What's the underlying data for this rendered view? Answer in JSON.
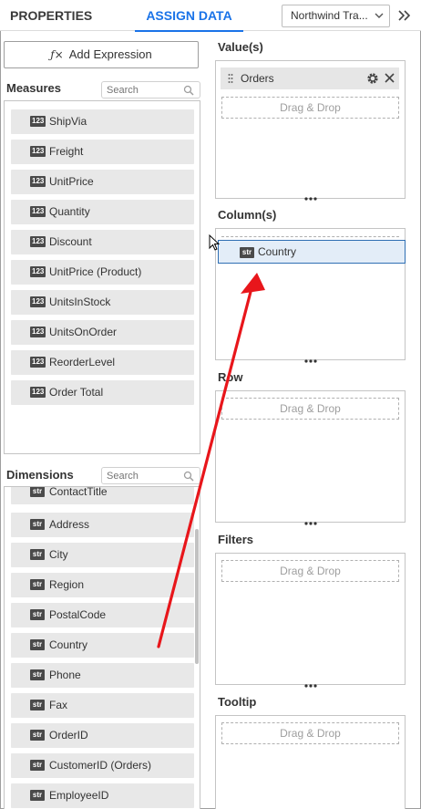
{
  "header": {
    "tabs": [
      {
        "label": "PROPERTIES",
        "active": false
      },
      {
        "label": "ASSIGN DATA",
        "active": true
      }
    ],
    "datasource_label": "Northwind Tra...",
    "accent_color": "#1a73e8"
  },
  "left": {
    "add_expression_label": "Add Expression",
    "measures": {
      "title": "Measures",
      "search_placeholder": "Search",
      "items": [
        {
          "type": "123",
          "name": "ShipVia"
        },
        {
          "type": "123",
          "name": "Freight"
        },
        {
          "type": "123",
          "name": "UnitPrice"
        },
        {
          "type": "123",
          "name": "Quantity"
        },
        {
          "type": "123",
          "name": "Discount"
        },
        {
          "type": "123",
          "name": "UnitPrice (Product)"
        },
        {
          "type": "123",
          "name": "UnitsInStock"
        },
        {
          "type": "123",
          "name": "UnitsOnOrder"
        },
        {
          "type": "123",
          "name": "ReorderLevel"
        },
        {
          "type": "123",
          "name": "Order Total"
        }
      ]
    },
    "dimensions": {
      "title": "Dimensions",
      "search_placeholder": "Search",
      "items": [
        {
          "type": "str",
          "name": "ContactTitle"
        },
        {
          "type": "str",
          "name": "Address"
        },
        {
          "type": "str",
          "name": "City"
        },
        {
          "type": "str",
          "name": "Region"
        },
        {
          "type": "str",
          "name": "PostalCode"
        },
        {
          "type": "str",
          "name": "Country"
        },
        {
          "type": "str",
          "name": "Phone"
        },
        {
          "type": "str",
          "name": "Fax"
        },
        {
          "type": "str",
          "name": "OrderID"
        },
        {
          "type": "str",
          "name": "CustomerID (Orders)"
        },
        {
          "type": "str",
          "name": "EmployeeID"
        }
      ]
    }
  },
  "right": {
    "values": {
      "title": "Value(s)",
      "chip_label": "Orders",
      "drop_label": "Drag & Drop"
    },
    "columns": {
      "title": "Column(s)"
    },
    "row": {
      "title": "Row",
      "drop_label": "Drag & Drop"
    },
    "filters": {
      "title": "Filters",
      "drop_label": "Drag & Drop"
    },
    "tooltip": {
      "title": "Tooltip",
      "drop_label": "Drag & Drop"
    }
  },
  "drag_ghost": {
    "type": "str",
    "name": "Country"
  },
  "annotation": {
    "arrow_color": "#e8161b"
  }
}
